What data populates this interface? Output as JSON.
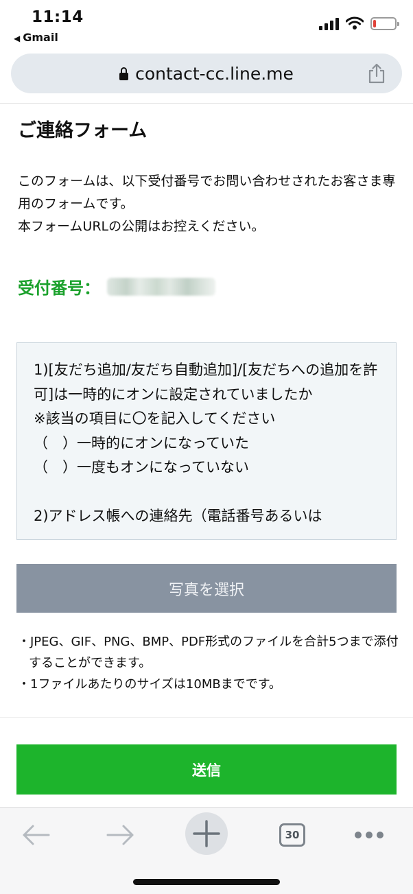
{
  "status_bar": {
    "time": "11:14",
    "back_app": "Gmail",
    "battery_color": "#e0433a"
  },
  "browser": {
    "url": "contact-cc.line.me",
    "icons": [
      "lock-icon",
      "share-icon",
      "back-arrow-icon",
      "forward-arrow-icon",
      "plus-icon",
      "tabs-icon",
      "more-icon"
    ],
    "tab_count": "30"
  },
  "form": {
    "title": "ご連絡フォーム",
    "intro_lines": [
      "このフォームは、以下受付番号でお問い合わせされたお客さま専用のフォームです。",
      "本フォームURLの公開はお控えください。"
    ],
    "receipt_label": "受付番号：",
    "message": "1)[友だち追加/友だち自動追加]/[友だちへの追加を許可]は一時的にオンに設定されていましたか\n※該当の項目に〇を記入してください\n（　）一時的にオンになっていた\n（　）一度もオンになっていない\n\n2)アドレス帳への連絡先（電話番号あるいは",
    "photo_button": "写真を選択",
    "notes": [
      "・JPEG、GIF、PNG、BMP、PDF形式のファイルを合計5つまで添付することができます。",
      "・1ファイルあたりのサイズは10MBまでです。"
    ],
    "send_button": "送信"
  },
  "colors": {
    "accent_green": "#1db42c",
    "receipt_green": "#1aa12b",
    "photo_button_gray": "#8893a1",
    "message_bg": "#f2f6f8"
  }
}
